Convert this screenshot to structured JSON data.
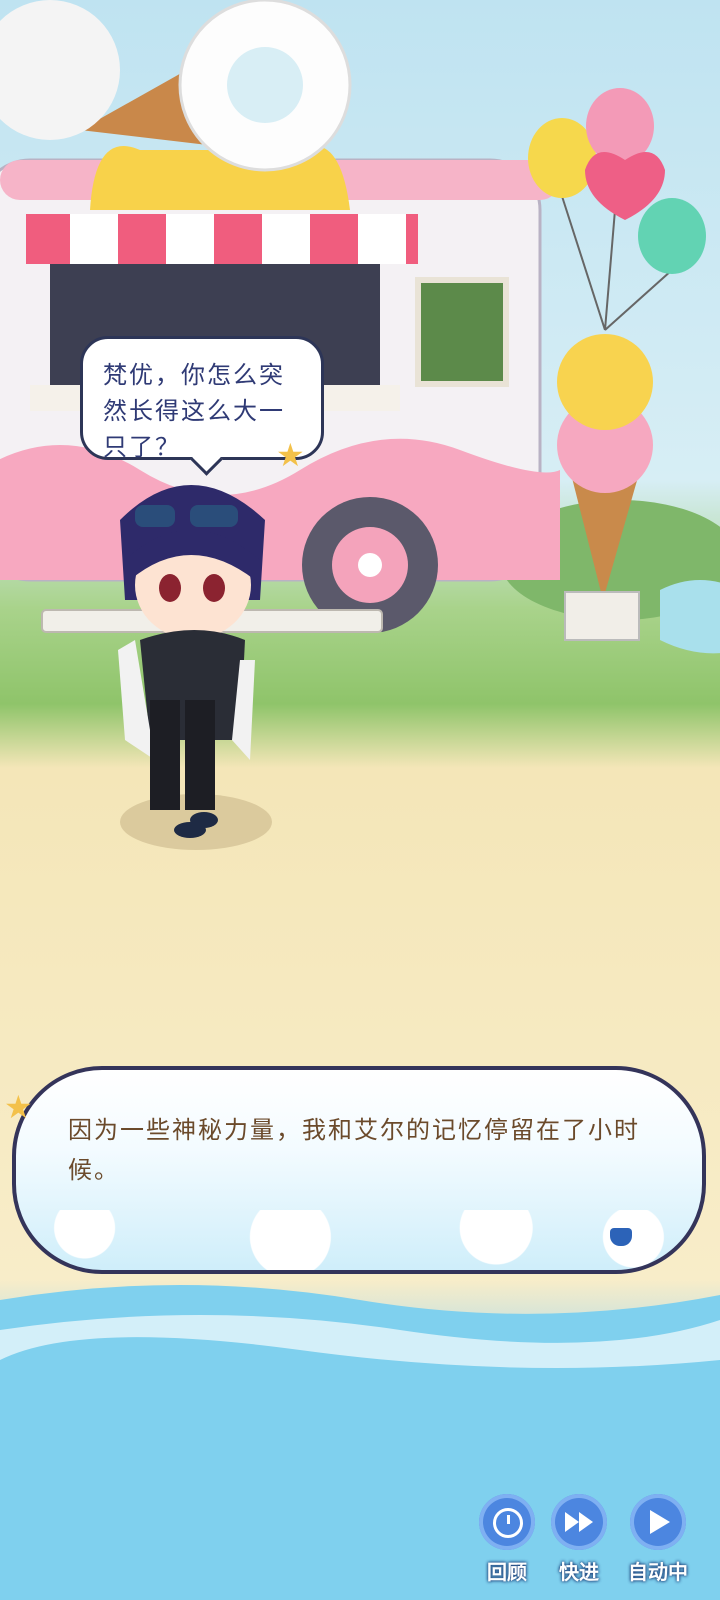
{
  "speech_bubble": {
    "text": "梵优，你怎么突然长得这么大一只了？"
  },
  "dialogue": {
    "text": "因为一些神秘力量，我和艾尔的记忆停留在了小时候。"
  },
  "controls": [
    {
      "label": "回顾",
      "icon": "clock-icon"
    },
    {
      "label": "快进",
      "icon": "fast-forward-icon"
    },
    {
      "label": "自动中",
      "icon": "play-icon"
    }
  ],
  "colors": {
    "accent": "#4c86e0",
    "dialog_text": "#6b4a2b",
    "speech_text": "#2f3a75"
  }
}
